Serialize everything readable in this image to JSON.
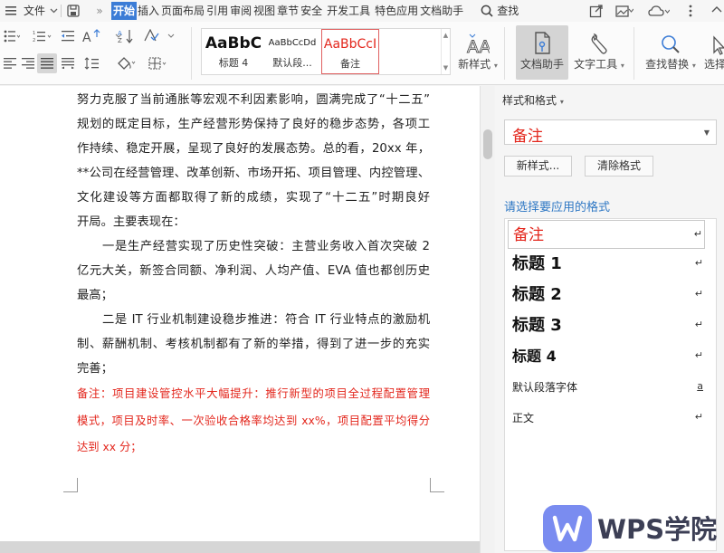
{
  "menubar": {
    "file_label": "文件",
    "tabs": [
      "开始",
      "插入",
      "页面布局",
      "引用",
      "审阅",
      "视图",
      "章节",
      "安全",
      "开发工具",
      "特色应用",
      "文档助手"
    ],
    "active_tab": "开始",
    "more_label": "»",
    "search_label": "查找"
  },
  "ribbon": {
    "styles": [
      {
        "preview": "AaBbC",
        "label": "标题 4"
      },
      {
        "preview": "AaBbCcDd",
        "label": "默认段..."
      },
      {
        "preview": "AaBbCcI",
        "label": "备注"
      }
    ],
    "new_style_label": "新样式",
    "doc_assistant_label": "文档助手",
    "text_tools_label": "文字工具",
    "find_replace_label": "查找替换",
    "select_label": "选择"
  },
  "document": {
    "lines": [
      "努力克服了当前通胀等宏观不利因素影响，圆满完成了“十二五”",
      "规划的既定目标，生产经营形势保持了良好的稳步态势，各项工",
      "作持续、稳定开展，呈现了良好的发展态势。总的看，20xx 年，",
      "**公司在经营管理、改革创新、市场开拓、项目管理、内控管理、",
      "文化建设等方面都取得了新的成绩，实现了“十二五”时期良好",
      "开局。主要表现在：",
      "一是生产经营实现了历史性突破：主营业务收入首次突破 2",
      "亿元大关，新签合同额、净利润、人均产值、EVA 值也都创历史",
      "最高；",
      "二是 IT 行业机制建设稳步推进：符合 IT 行业特点的激励机",
      "制、薪酬机制、考核机制都有了新的举措，得到了进一步的充实",
      "完善；"
    ],
    "note_lines": [
      "备注：项目建设管控水平大幅提升：推行新型的项目全过程配置管理",
      "模式，项目及时率、一次验收合格率均达到 xx%，项目配置平均得分",
      "达到 xx 分；"
    ]
  },
  "pane": {
    "title": "样式和格式",
    "current_style": "备注",
    "new_style_button": "新样式...",
    "clear_format_button": "清除格式",
    "hint": "请选择要应用的格式",
    "items": [
      {
        "name": "备注",
        "mark": "↵"
      },
      {
        "name": "标题  1",
        "mark": "↵"
      },
      {
        "name": "标题  2",
        "mark": "↵"
      },
      {
        "name": "标题  3",
        "mark": "↵"
      },
      {
        "name": "标题  4",
        "mark": "↵"
      },
      {
        "name": "默认段落字体",
        "mark": "a"
      },
      {
        "name": "正文",
        "mark": "↵"
      }
    ]
  },
  "brand": {
    "text": "WPS学院"
  },
  "colors": {
    "accent": "#3b7cd6",
    "note_red": "#e3261c",
    "hint_blue": "#2f78c4"
  }
}
